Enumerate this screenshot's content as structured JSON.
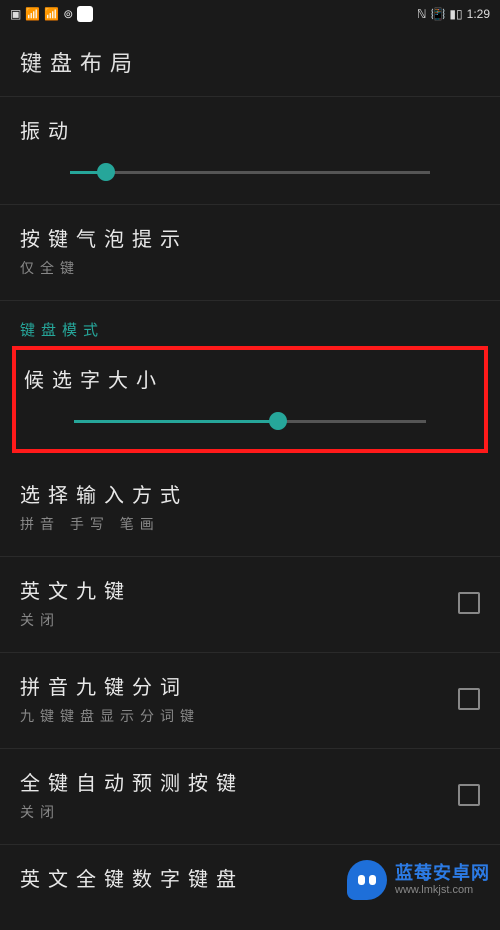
{
  "status": {
    "hd": "HD",
    "signal": "4G",
    "time": "1:29"
  },
  "header": {
    "title": "键盘布局"
  },
  "vibration": {
    "title": "振动",
    "slider_percent": 10
  },
  "bubble": {
    "title": "按键气泡提示",
    "sub": "仅全键"
  },
  "mode_label": "键盘模式",
  "candidate": {
    "title": "候选字大小",
    "slider_percent": 58
  },
  "input_method": {
    "title": "选择输入方式",
    "sub": "拼音 手写 笔画"
  },
  "en_nine": {
    "title": "英文九键",
    "sub": "关闭"
  },
  "pinyin_split": {
    "title": "拼音九键分词",
    "sub": "九键键盘显示分词键"
  },
  "auto_predict": {
    "title": "全键自动预测按键",
    "sub": "关闭"
  },
  "en_full_digit": {
    "title": "英文全键数字键盘"
  },
  "watermark": {
    "name": "蓝莓安卓网",
    "url": "www.lmkjst.com"
  }
}
